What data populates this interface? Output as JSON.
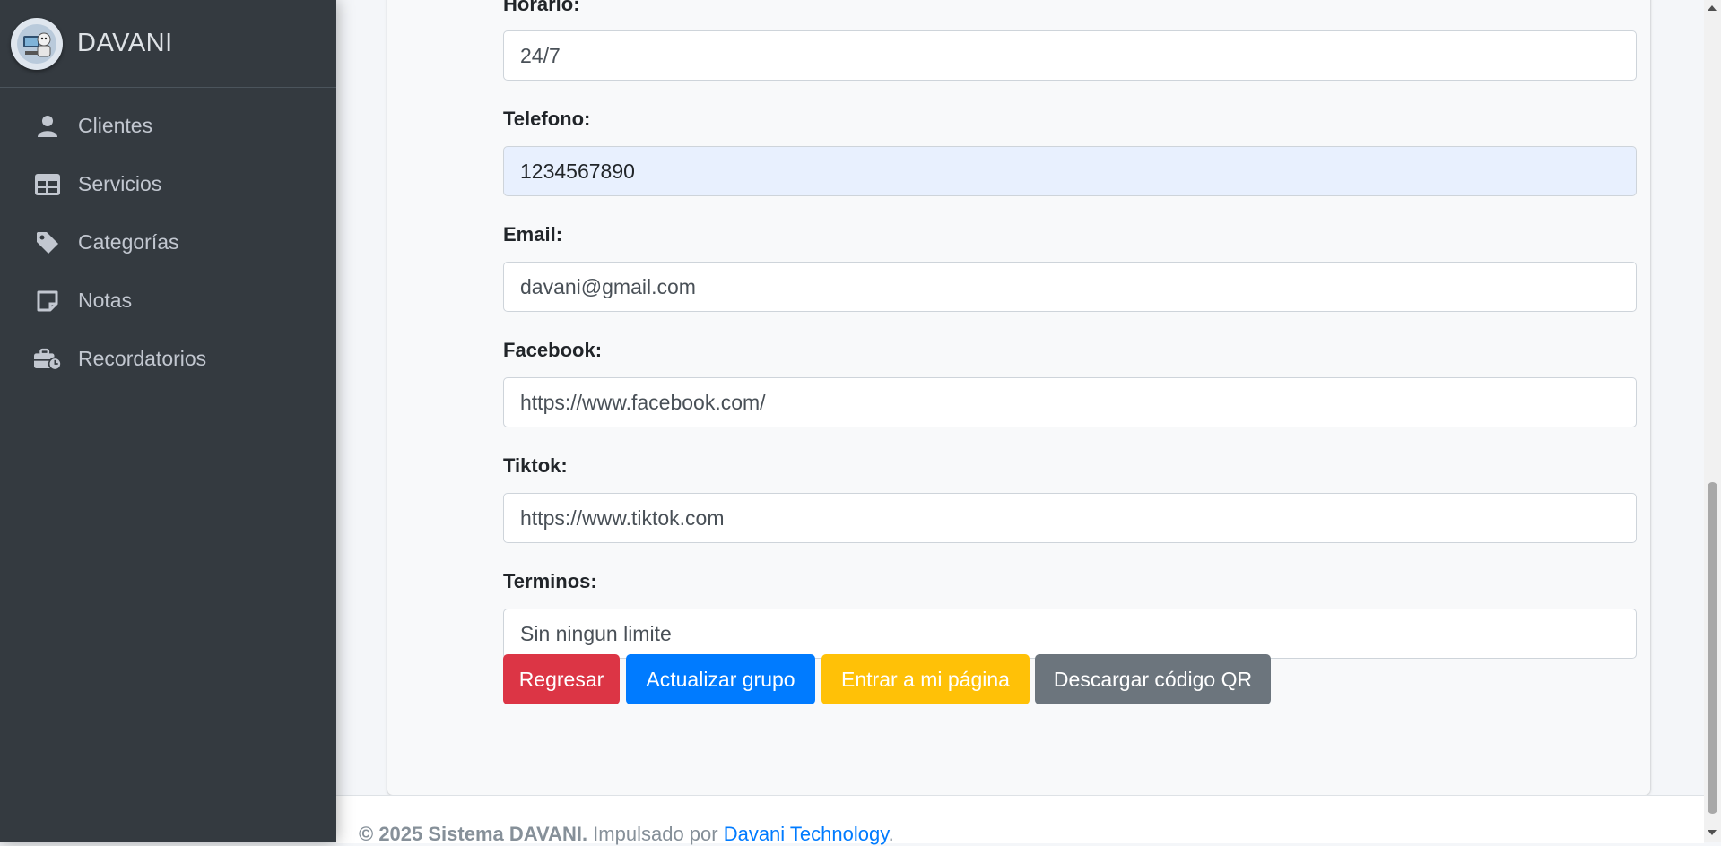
{
  "brand": {
    "name": "DAVANI",
    "logo_icon": "robot-avatar-icon"
  },
  "sidebar": {
    "items": [
      {
        "label": "Clientes",
        "icon": "user-icon"
      },
      {
        "label": "Servicios",
        "icon": "table-icon"
      },
      {
        "label": "Categorías",
        "icon": "tag-icon"
      },
      {
        "label": "Notas",
        "icon": "note-icon"
      },
      {
        "label": "Recordatorios",
        "icon": "briefcase-clock-icon"
      }
    ]
  },
  "form": {
    "horario": {
      "label": "Horario:",
      "value": "24/7"
    },
    "telefono": {
      "label": "Telefono:",
      "value": "1234567890"
    },
    "email": {
      "label": "Email:",
      "value": "davani@gmail.com"
    },
    "facebook": {
      "label": "Facebook:",
      "value": "https://www.facebook.com/"
    },
    "tiktok": {
      "label": "Tiktok:",
      "value": "https://www.tiktok.com"
    },
    "terminos": {
      "label": "Terminos:",
      "value": "Sin ningun limite"
    }
  },
  "buttons": {
    "back": "Regresar",
    "update": "Actualizar grupo",
    "enter": "Entrar a mi página",
    "qr": "Descargar código QR"
  },
  "footer": {
    "copyright": "© 2025 Sistema DAVANI.",
    "powered": " Impulsado por ",
    "link": "Davani Technology",
    "end": "."
  },
  "colors": {
    "sidebar_bg": "#343a40",
    "btn_danger": "#dc3545",
    "btn_primary": "#007bff",
    "btn_warning": "#ffc107",
    "btn_secondary": "#6c757d"
  }
}
